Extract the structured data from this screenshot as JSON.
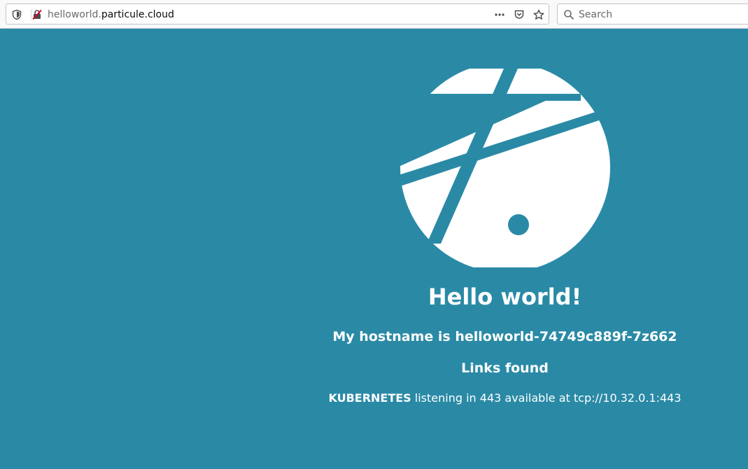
{
  "browser": {
    "url_subdomain": "helloworld.",
    "url_host": "particule.cloud",
    "search_placeholder": "Search",
    "icons": [
      "shield-icon",
      "insecure-lock-icon",
      "more-dots-icon",
      "pocket-icon",
      "bookmark-star-icon",
      "search-icon"
    ]
  },
  "page": {
    "background_color": "#2a8aa6",
    "logo_icon": "particule-logo-icon",
    "heading": "Hello world!",
    "hostname_line": "My hostname is helloworld-74749c889f-7z662",
    "links_heading": "Links found",
    "links": [
      {
        "name": "KUBERNETES",
        "text": " listening in 443 available at tcp://10.32.0.1:443"
      }
    ]
  }
}
